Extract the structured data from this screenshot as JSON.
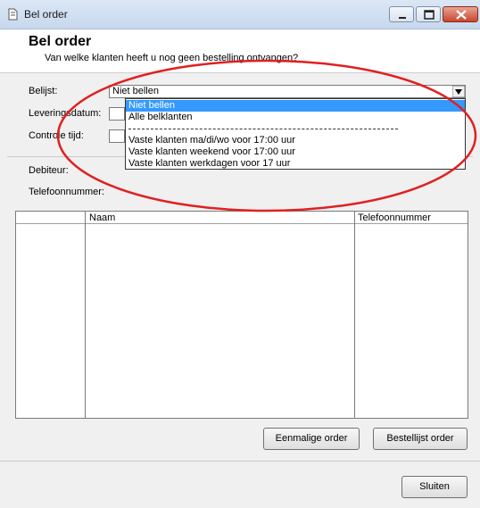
{
  "window": {
    "title": "Bel order"
  },
  "header": {
    "title": "Bel order",
    "subtitle": "Van welke klanten heeft u nog geen bestelling ontvangen?"
  },
  "form": {
    "belllijst_label": "Belijst:",
    "leveringsdatum_label": "Leveringsdatum:",
    "controle_label": "Controle tijd:",
    "debiteur_label": "Debiteur:",
    "telefoon_label": "Telefoonnummer:"
  },
  "combo": {
    "selected": "Niet bellen",
    "options": [
      "Niet bellen",
      "Alle belklanten",
      "------------------------------------------------------------------------------------------------",
      "Vaste klanten ma/di/wo voor 17:00 uur",
      "Vaste klanten weekend voor 17:00 uur",
      "Vaste klanten werkdagen voor 17 uur"
    ]
  },
  "table": {
    "columns": [
      "",
      "Naam",
      "Telefoonnummer"
    ]
  },
  "buttons": {
    "eenmalige": "Eenmalige order",
    "bellijst": "Bestellijst order",
    "sluiten": "Sluiten"
  },
  "colors": {
    "selection": "#3399ff",
    "annotation": "#e02020"
  }
}
